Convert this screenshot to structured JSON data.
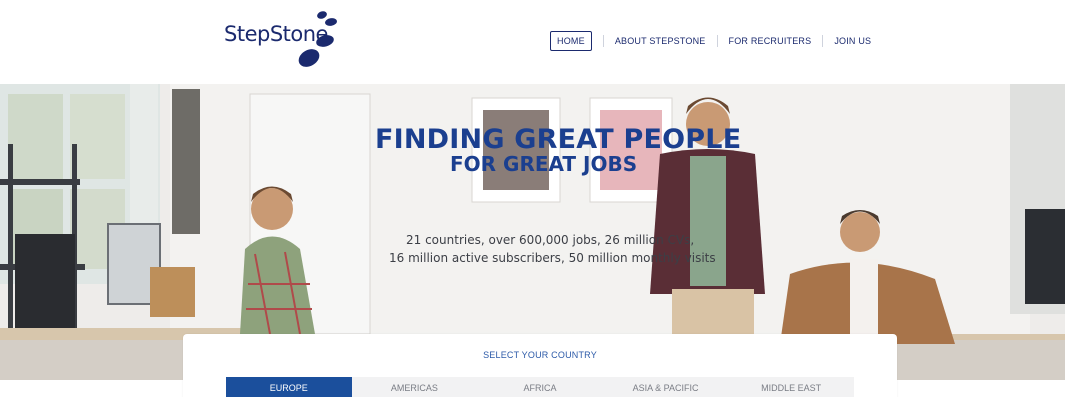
{
  "brand": {
    "name": "StepStone",
    "color": "#1b2a6e"
  },
  "nav": {
    "items": [
      {
        "label": "HOME",
        "active": true
      },
      {
        "label": "ABOUT STEPSTONE",
        "active": false
      },
      {
        "label": "FOR RECRUITERS",
        "active": false
      },
      {
        "label": "JOIN US",
        "active": false
      }
    ]
  },
  "hero": {
    "title_line1": "FINDING GREAT PEOPLE",
    "title_line2": "FOR GREAT JOBS",
    "stat_line1": "21 countries, over 600,000 jobs, 26 million CVs,",
    "stat_line2": "16 million active subscribers, 50 million monthly visits",
    "accent_color": "#1b3f8f"
  },
  "country_selector": {
    "title": "SELECT YOUR COUNTRY",
    "tabs": [
      {
        "label": "EUROPE",
        "active": true
      },
      {
        "label": "AMERICAS",
        "active": false
      },
      {
        "label": "AFRICA",
        "active": false
      },
      {
        "label": "ASIA & PACIFIC",
        "active": false
      },
      {
        "label": "MIDDLE EAST",
        "active": false
      }
    ],
    "active_color": "#1b4f9c"
  }
}
